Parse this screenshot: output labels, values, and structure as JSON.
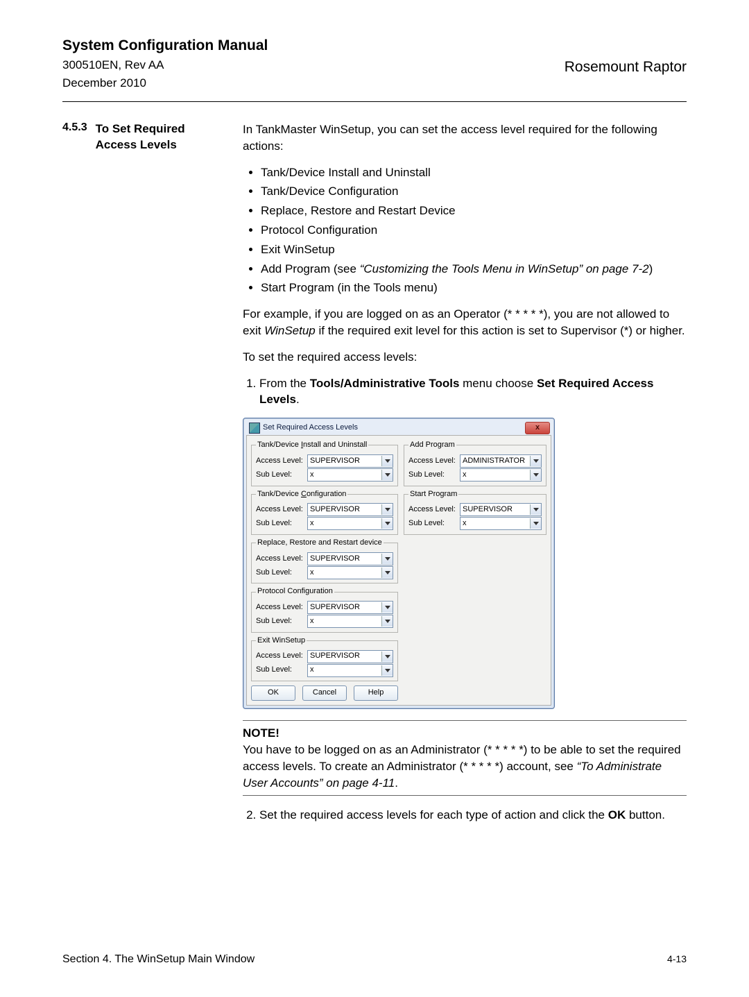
{
  "header": {
    "title": "System Configuration Manual",
    "docnum": "300510EN, Rev AA",
    "date": "December 2010",
    "product": "Rosemount Raptor"
  },
  "section": {
    "num": "4.5.3",
    "title": "To Set Required Access Levels"
  },
  "body": {
    "intro": "In TankMaster WinSetup, you can set the access level required for the following actions:",
    "bullets": [
      "Tank/Device Install and Uninstall",
      "Tank/Device Configuration",
      "Replace, Restore and Restart Device",
      "Protocol Configuration",
      "Exit WinSetup"
    ],
    "bullet_addprog_pre": "Add Program (see ",
    "bullet_addprog_em": "“Customizing the Tools Menu in WinSetup” on page 7-2",
    "bullet_addprog_post": ")",
    "bullet_start": "Start Program (in the Tools menu)",
    "example_pre": "For example, if you are logged on as an Operator (* * * * *), you are not allowed to exit ",
    "example_em": "WinSetup",
    "example_post": " if the required exit level for this action is set to Supervisor (*) or higher.",
    "to_set": "To set the required access levels:",
    "step1_pre": "From the ",
    "step1_b1": "Tools/Administrative Tools",
    "step1_mid": " menu choose ",
    "step1_b2": "Set Required Access Levels",
    "step1_post": ".",
    "note_title": "NOTE!",
    "note_pre": "You have to be logged on as an Administrator (* * * * *) to be able to set the required access levels. To create an Administrator (* * * * *) account, see ",
    "note_em": "“To Administrate User Accounts” on page 4-11",
    "note_post": ".",
    "step2_pre": "Set the required access levels for each type of action and click the ",
    "step2_b": "OK",
    "step2_post": " button."
  },
  "dialog": {
    "title": "Set Required Access Levels",
    "close": "x",
    "lbl_access": "Access Level:",
    "lbl_sub": "Sub Level:",
    "lbl_underline_I": "I",
    "lbl_underline_C": "C",
    "groups_left": [
      {
        "legend_pre": "Tank/Device ",
        "legend_u": "I",
        "legend_post": "nstall and Uninstall",
        "access": "SUPERVISOR",
        "sub": "x"
      },
      {
        "legend_pre": "Tank/Device ",
        "legend_u": "C",
        "legend_post": "onfiguration",
        "access": "SUPERVISOR",
        "sub": "x"
      },
      {
        "legend_pre": "Replace, Restore and Restart device",
        "legend_u": "",
        "legend_post": "",
        "access": "SUPERVISOR",
        "sub": "x"
      },
      {
        "legend_pre": "Protocol Configuration",
        "legend_u": "",
        "legend_post": "",
        "access": "SUPERVISOR",
        "sub": "x"
      },
      {
        "legend_pre": "Exit WinSetup",
        "legend_u": "",
        "legend_post": "",
        "access": "SUPERVISOR",
        "sub": "x"
      }
    ],
    "groups_right": [
      {
        "legend": "Add Program",
        "access": "ADMINISTRATOR",
        "sub": "x"
      },
      {
        "legend": "Start Program",
        "access": "SUPERVISOR",
        "sub": "x"
      }
    ],
    "btn_ok": "OK",
    "btn_cancel": "Cancel",
    "btn_help": "Help"
  },
  "footer": {
    "left": "Section 4. The WinSetup Main Window",
    "right": "4-13"
  }
}
